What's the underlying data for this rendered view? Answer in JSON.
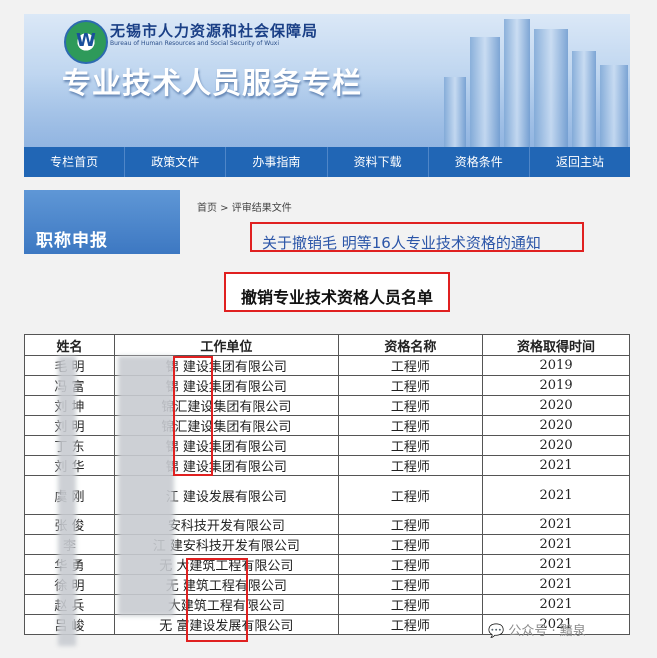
{
  "header": {
    "org_name_cn": "无锡市人力资源和社会保障局",
    "org_name_en": "Bureau of Human Resources and Social Security of Wuxi",
    "banner_title": "专业技术人员服务专栏"
  },
  "nav": {
    "items": [
      "专栏首页",
      "政策文件",
      "办事指南",
      "资料下载",
      "资格条件",
      "返回主站"
    ]
  },
  "sidebar": {
    "title": "职称申报"
  },
  "breadcrumb": "首页 > 评审结果文件",
  "notice_title": "关于撤销毛  明等16人专业技术资格的通知",
  "list_title": "撤销专业技术资格人员名单",
  "table": {
    "headers": [
      "姓名",
      "工作单位",
      "资格名称",
      "资格取得时间"
    ],
    "rows": [
      {
        "name": "毛  明",
        "unit": "锦  建设集团有限公司",
        "qual": "工程师",
        "year": "2019"
      },
      {
        "name": "冯  富",
        "unit": "锦  建设集团有限公司",
        "qual": "工程师",
        "year": "2019"
      },
      {
        "name": "刘  坤",
        "unit": "锦汇建设集团有限公司",
        "qual": "工程师",
        "year": "2020"
      },
      {
        "name": "刘  明",
        "unit": "锦汇建设集团有限公司",
        "qual": "工程师",
        "year": "2020"
      },
      {
        "name": "丁  东",
        "unit": "锦  建设集团有限公司",
        "qual": "工程师",
        "year": "2020"
      },
      {
        "name": "刘  华",
        "unit": "锦  建设集团有限公司",
        "qual": "工程师",
        "year": "2021"
      },
      {
        "name": "虞  刚",
        "unit": "江  建设发展有限公司",
        "qual": "工程师",
        "year": "2021"
      },
      {
        "name": "张  俊",
        "unit": "  安科技开发有限公司",
        "qual": "工程师",
        "year": "2021"
      },
      {
        "name": "李  ",
        "unit": "江  建安科技开发有限公司",
        "qual": "工程师",
        "year": "2021"
      },
      {
        "name": "华  勇",
        "unit": "无  大建筑工程有限公司",
        "qual": "工程师",
        "year": "2021"
      },
      {
        "name": "徐  明",
        "unit": "无  建筑工程有限公司",
        "qual": "工程师",
        "year": "2021"
      },
      {
        "name": "赵  兵",
        "unit": "  大建筑工程有限公司",
        "qual": "工程师",
        "year": "2021"
      },
      {
        "name": "吕  峻",
        "unit": "无  富建设发展有限公司",
        "qual": "工程师",
        "year": "2021"
      }
    ]
  },
  "watermark": "公众号 · 黯泉",
  "colors": {
    "nav_bg": "#2166b5",
    "highlight_border": "#e02020",
    "notice_text": "#2b55a8"
  }
}
